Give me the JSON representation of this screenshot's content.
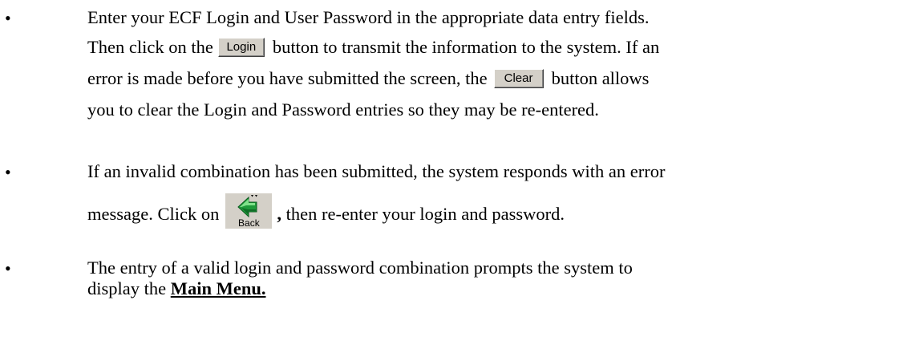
{
  "bullets": [
    {
      "symbol": "•",
      "line1": "Enter your ECF Login and User Password in the appropriate data entry fields.",
      "line2_before": "Then click on the",
      "login_button": "Login",
      "line2_after": "button to transmit the information to the system. If an",
      "line3_before": "error is made before you have submitted the screen, the",
      "clear_button": "Clear",
      "line3_after": "button allows",
      "line4": "you to clear the Login and Password entries so they may be re-entered."
    },
    {
      "symbol": "•",
      "line1": "If an invalid combination has been submitted, the system responds with an error",
      "line2_before": "message.  Click on",
      "back_button": "Back",
      "line2_comma": ",",
      "line2_after": " then re-enter your login and password."
    },
    {
      "symbol": "•",
      "line1": "The entry of a valid login and password combination prompts the system to",
      "line2_before": "display the ",
      "main_menu": "Main Menu."
    }
  ],
  "icons": {
    "back": "back-arrow-icon"
  },
  "colors": {
    "button_face": "#d4d0c8",
    "back_icon_green": "#1e9a3a"
  }
}
